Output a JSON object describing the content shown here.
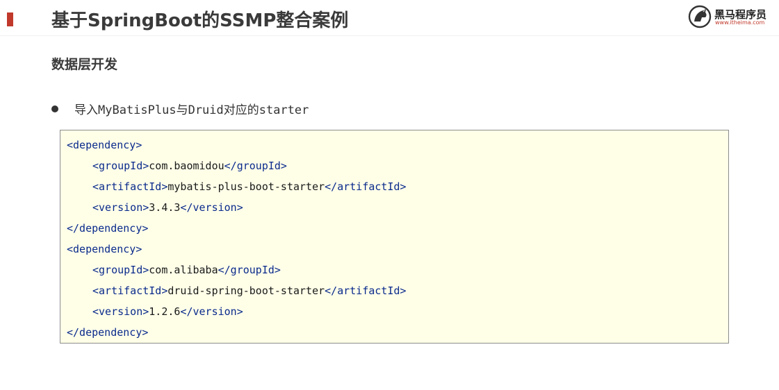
{
  "header": {
    "title": "基于SpringBoot的SSMP整合案例",
    "logo": {
      "icon": "horse-logo-icon",
      "name": "黑马程序员",
      "url": "www.itheima.com",
      "url_color": "#c0392b"
    },
    "accent_color": "#c0392b"
  },
  "section": {
    "title": "数据层开发"
  },
  "bullet": {
    "text": "导入MyBatisPlus与Druid对应的starter"
  },
  "code": {
    "dependencies": [
      {
        "open": "<dependency>",
        "close": "</dependency>",
        "group_open": "<groupId>",
        "group_value": "com.baomidou",
        "group_close": "</groupId>",
        "artifact_open": "<artifactId>",
        "artifact_value": "mybatis-plus-boot-starter",
        "artifact_close": "</artifactId>",
        "version_open": "<version>",
        "version_value": "3.4.3",
        "version_close": "</version>"
      },
      {
        "open": "<dependency>",
        "close": "</dependency>",
        "group_open": "<groupId>",
        "group_value": "com.alibaba",
        "group_close": "</groupId>",
        "artifact_open": "<artifactId>",
        "artifact_value": "druid-spring-boot-starter",
        "artifact_close": "</artifactId>",
        "version_open": "<version>",
        "version_value": "1.2.6",
        "version_close": "</version>"
      }
    ],
    "background": "#ffffe8",
    "tag_color": "#0a2a8c"
  }
}
